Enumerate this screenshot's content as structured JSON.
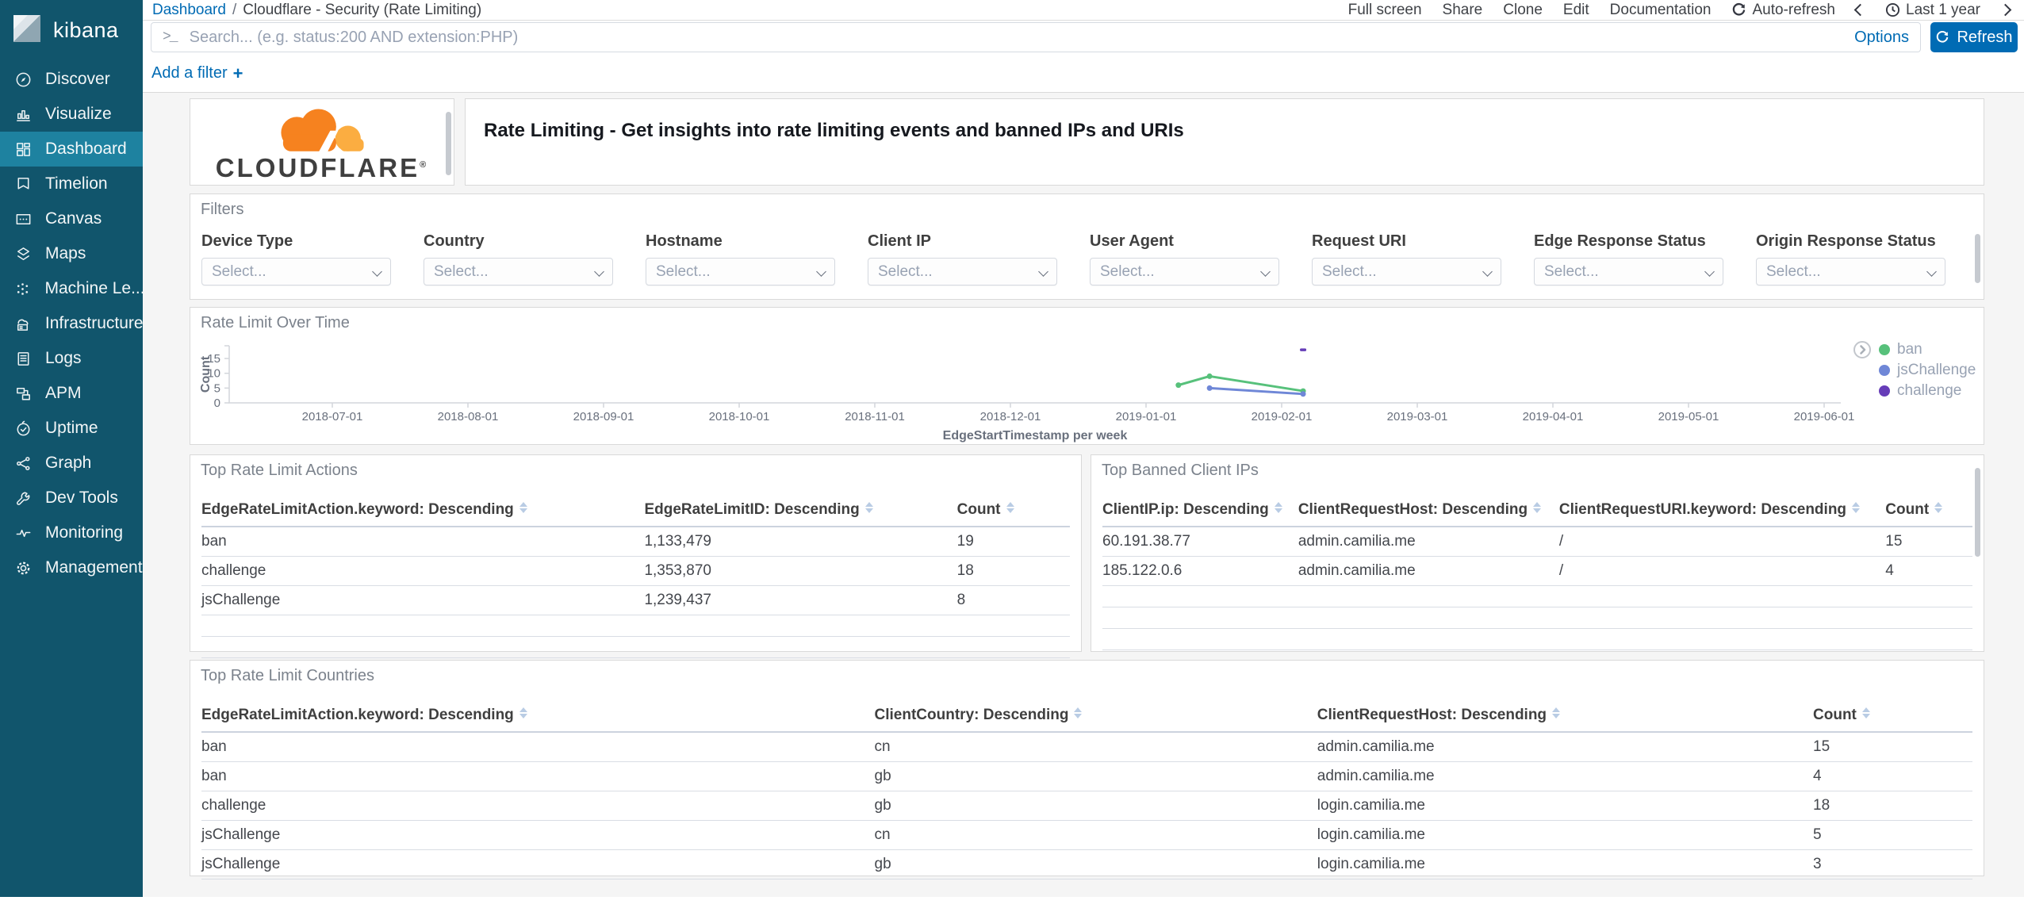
{
  "sidebar": {
    "logo_text": "kibana",
    "items": [
      {
        "label": "Discover",
        "icon": "discover",
        "active": false
      },
      {
        "label": "Visualize",
        "icon": "visualize",
        "active": false
      },
      {
        "label": "Dashboard",
        "icon": "dashboard",
        "active": true
      },
      {
        "label": "Timelion",
        "icon": "timelion",
        "active": false
      },
      {
        "label": "Canvas",
        "icon": "canvas",
        "active": false
      },
      {
        "label": "Maps",
        "icon": "maps",
        "active": false
      },
      {
        "label": "Machine Le...",
        "icon": "ml",
        "active": false
      },
      {
        "label": "Infrastructure",
        "icon": "infrastructure",
        "active": false
      },
      {
        "label": "Logs",
        "icon": "logs",
        "active": false
      },
      {
        "label": "APM",
        "icon": "apm",
        "active": false
      },
      {
        "label": "Uptime",
        "icon": "uptime",
        "active": false
      },
      {
        "label": "Graph",
        "icon": "graph",
        "active": false
      },
      {
        "label": "Dev Tools",
        "icon": "devtools",
        "active": false
      },
      {
        "label": "Monitoring",
        "icon": "monitoring",
        "active": false
      },
      {
        "label": "Management",
        "icon": "management",
        "active": false
      }
    ]
  },
  "topbar": {
    "breadcrumb": {
      "link": "Dashboard",
      "separator": "/",
      "current": "Cloudflare - Security (Rate Limiting)"
    },
    "menu_items": [
      "Full screen",
      "Share",
      "Clone",
      "Edit",
      "Documentation"
    ],
    "auto_refresh_label": "Auto-refresh",
    "time_range": "Last 1 year",
    "search_placeholder": "Search... (e.g. status:200 AND extension:PHP)",
    "options_label": "Options",
    "refresh_label": "Refresh",
    "add_filter_label": "Add a filter",
    "add_filter_plus": "+"
  },
  "panels": {
    "logo": {
      "brand": "CLOUDFLARE",
      "registered": "®"
    },
    "header": {
      "title": "Rate Limiting - Get insights into rate limiting events and banned IPs and URIs"
    },
    "filters": {
      "title": "Filters",
      "placeholder": "Select...",
      "fields": [
        "Device Type",
        "Country",
        "Hostname",
        "Client IP",
        "User Agent",
        "Request URI",
        "Edge Response Status",
        "Origin Response Status"
      ]
    },
    "chart": {
      "title": "Rate Limit Over Time"
    },
    "actions": {
      "title": "Top Rate Limit Actions",
      "headers": [
        "EdgeRateLimitAction.keyword: Descending",
        "EdgeRateLimitID: Descending",
        "Count"
      ],
      "col_widths": [
        "51%",
        "36%",
        "13%"
      ],
      "rows": [
        [
          "ban",
          "1,133,479",
          "19"
        ],
        [
          "challenge",
          "1,353,870",
          "18"
        ],
        [
          "jsChallenge",
          "1,239,437",
          "8"
        ]
      ],
      "empty_rows": 2
    },
    "ips": {
      "title": "Top Banned Client IPs",
      "headers": [
        "ClientIP.ip: Descending",
        "ClientRequestHost: Descending",
        "ClientRequestURI.keyword: Descending",
        "Count"
      ],
      "col_widths": [
        "22.5%",
        "30%",
        "37.5%",
        "10%"
      ],
      "rows": [
        [
          "60.191.38.77",
          "admin.camilia.me",
          "/",
          "15"
        ],
        [
          "185.122.0.6",
          "admin.camilia.me",
          "/",
          "4"
        ]
      ],
      "empty_rows": 3
    },
    "countries": {
      "title": "Top Rate Limit Countries",
      "headers": [
        "EdgeRateLimitAction.keyword: Descending",
        "ClientCountry: Descending",
        "ClientRequestHost: Descending",
        "Count"
      ],
      "col_widths": [
        "38%",
        "25%",
        "28%",
        "9%"
      ],
      "rows": [
        [
          "ban",
          "cn",
          "admin.camilia.me",
          "15"
        ],
        [
          "ban",
          "gb",
          "admin.camilia.me",
          "4"
        ],
        [
          "challenge",
          "gb",
          "login.camilia.me",
          "18"
        ],
        [
          "jsChallenge",
          "cn",
          "login.camilia.me",
          "5"
        ],
        [
          "jsChallenge",
          "gb",
          "login.camilia.me",
          "3"
        ]
      ],
      "empty_rows": 0
    }
  },
  "chart_data": {
    "type": "line",
    "title": "Rate Limit Over Time",
    "xlabel": "EdgeStartTimestamp per week",
    "ylabel": "Count",
    "x_ticks": [
      "2018-07-01",
      "2018-08-01",
      "2018-09-01",
      "2018-10-01",
      "2018-11-01",
      "2018-12-01",
      "2019-01-01",
      "2019-02-01",
      "2019-03-01",
      "2019-04-01",
      "2019-05-01",
      "2019-06-01"
    ],
    "y_ticks": [
      0,
      5,
      10,
      15
    ],
    "ylim": [
      0,
      17.5
    ],
    "legend_position": "right",
    "grid": false,
    "series": [
      {
        "name": "ban",
        "color": "#57C17B",
        "points": [
          [
            "2019-01-07",
            6
          ],
          [
            "2019-01-14",
            9
          ],
          [
            "2019-02-04",
            4
          ]
        ]
      },
      {
        "name": "jsChallenge",
        "color": "#6F87D7",
        "points": [
          [
            "2019-01-14",
            5
          ],
          [
            "2019-02-04",
            3
          ]
        ]
      },
      {
        "name": "challenge",
        "color": "#663DB8",
        "points": [
          [
            "2019-02-04",
            18
          ]
        ]
      }
    ]
  },
  "colors": {
    "sidebar_bg": "#11556C",
    "sidebar_active": "#1E82A0",
    "link_blue": "#006BB4",
    "button_blue": "#006BB4",
    "cloudflare_orange": "#F6821F",
    "cloudflare_light_orange": "#FBAD41"
  }
}
